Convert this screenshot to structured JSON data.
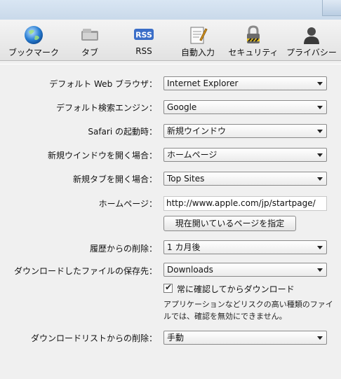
{
  "toolbar": {
    "items": [
      {
        "label": "ブックマーク",
        "icon": "globe-icon"
      },
      {
        "label": "タブ",
        "icon": "tabs-icon"
      },
      {
        "label": "RSS",
        "icon": "rss-icon"
      },
      {
        "label": "自動入力",
        "icon": "autofill-icon"
      },
      {
        "label": "セキュリティ",
        "icon": "lock-icon"
      },
      {
        "label": "プライバシー",
        "icon": "person-icon"
      }
    ],
    "rss_badge": "RSS"
  },
  "settings": {
    "default_browser": {
      "label": "デフォルト Web ブラウザ：",
      "value": "Internet Explorer"
    },
    "default_search": {
      "label": "デフォルト検索エンジン：",
      "value": "Google"
    },
    "on_startup": {
      "label": "Safari の起動時：",
      "value": "新規ウインドウ"
    },
    "new_window": {
      "label": "新規ウインドウを開く場合：",
      "value": "ホームページ"
    },
    "new_tab": {
      "label": "新規タブを開く場合：",
      "value": "Top Sites"
    },
    "homepage": {
      "label": "ホームページ：",
      "value": "http://www.apple.com/jp/startpage/",
      "button": "現在開いているページを指定"
    },
    "history": {
      "label": "履歴からの削除：",
      "value": "1 カ月後"
    },
    "downloads_location": {
      "label": "ダウンロードしたファイルの保存先：",
      "value": "Downloads"
    },
    "confirm_download": {
      "label": "常に確認してからダウンロード",
      "checked": true,
      "note": "アプリケーションなどリスクの高い種類のファイルでは、確認を無効にできません。"
    },
    "download_list": {
      "label": "ダウンロードリストからの削除：",
      "value": "手動"
    }
  }
}
